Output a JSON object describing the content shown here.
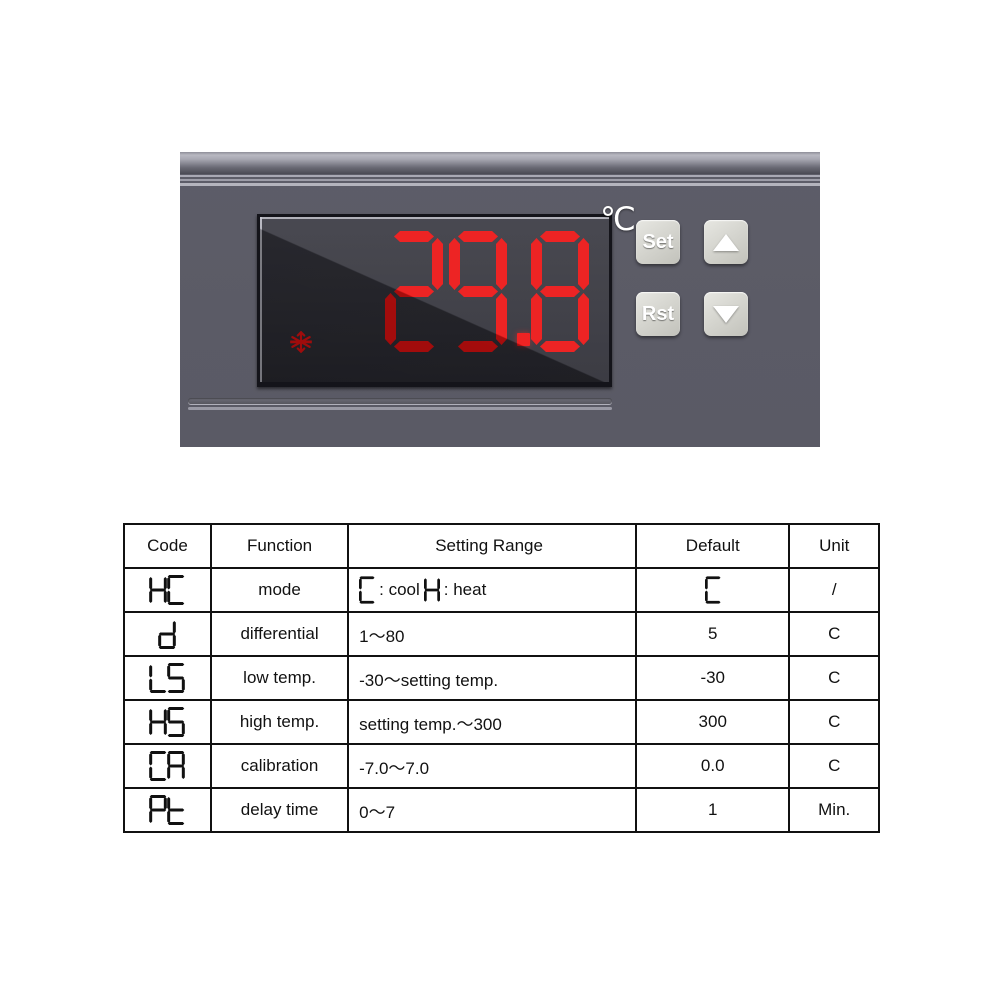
{
  "device": {
    "name": "digital-temperature-controller",
    "display_value": "29.8",
    "unit_symbol": "℃",
    "indicator_icon": "snowflake-icon",
    "indicator_color": "#ec1212",
    "digit_color": "#ec1212",
    "panel_color": "#5b5b66",
    "buttons": [
      {
        "id": "set",
        "label": "Set",
        "icon": null
      },
      {
        "id": "rst",
        "label": "Rst",
        "icon": null
      },
      {
        "id": "up",
        "label": "",
        "icon": "triangle-up-icon"
      },
      {
        "id": "down",
        "label": "",
        "icon": "triangle-down-icon"
      }
    ]
  },
  "table": {
    "headers": [
      "Code",
      "Function",
      "Setting Range",
      "Default",
      "Unit"
    ],
    "rows": [
      {
        "code": "HC",
        "function": "mode",
        "range_prefix": "C",
        "range_mid": ": cool",
        "range_symbol": "H",
        "range_suffix": ": heat",
        "range_is_symbolic": true,
        "range_text": "C : cool  H : heat",
        "default": "C",
        "default_is_symbolic": true,
        "unit": "/"
      },
      {
        "code": "d",
        "function": "differential",
        "range_text": "1～80",
        "range_is_symbolic": false,
        "default": "5",
        "default_is_symbolic": false,
        "unit": "C"
      },
      {
        "code": "LS",
        "function": "low temp.",
        "range_text": "-30～setting temp.",
        "range_is_symbolic": false,
        "default": "-30",
        "default_is_symbolic": false,
        "unit": "C"
      },
      {
        "code": "HS",
        "function": "high temp.",
        "range_text": "setting temp.～300",
        "range_is_symbolic": false,
        "default": "300",
        "default_is_symbolic": false,
        "unit": "C"
      },
      {
        "code": "CA",
        "function": "calibration",
        "range_text": "-7.0～7.0",
        "range_is_symbolic": false,
        "default": "0.0",
        "default_is_symbolic": false,
        "unit": "C"
      },
      {
        "code": "Pt",
        "function": "delay time",
        "range_text": "0～7",
        "range_is_symbolic": false,
        "default": "1",
        "default_is_symbolic": false,
        "unit": "Min."
      }
    ]
  }
}
